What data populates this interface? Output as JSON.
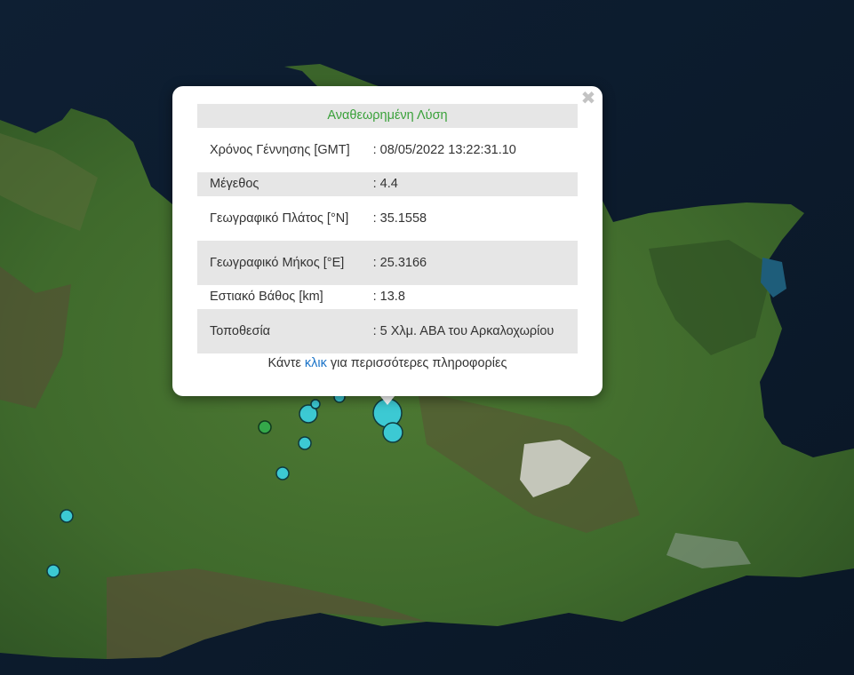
{
  "popup": {
    "title": "Αναθεωρημένη Λύση",
    "close_label": "✖",
    "rows": [
      {
        "label": "Χρόνος Γέννησης [GMT]",
        "value": ": 08/05/2022 13:22:31.10"
      },
      {
        "label": "Μέγεθος",
        "value": ": 4.4"
      },
      {
        "label": "Γεωγραφικό Πλάτος [°N]",
        "value": ": 35.1558"
      },
      {
        "label": "Γεωγραφικό Μήκος [°E]",
        "value": ": 25.3166"
      },
      {
        "label": "Εστιακό Βάθος [km]",
        "value": ": 13.8"
      },
      {
        "label": "Τοποθεσία",
        "value": ": 5 Χλμ. ΑΒΑ του Αρκαλοχωρίου"
      }
    ],
    "more_prefix": "Κάντε ",
    "more_link": "κλικ",
    "more_suffix": " για περισσότερες πληροφορίες"
  },
  "map": {
    "sea_color": "#0b1a2a",
    "land_color": "#3f6a2c",
    "marker_colors": {
      "cyan": "#3cc9d3",
      "green": "#34a84a"
    }
  }
}
